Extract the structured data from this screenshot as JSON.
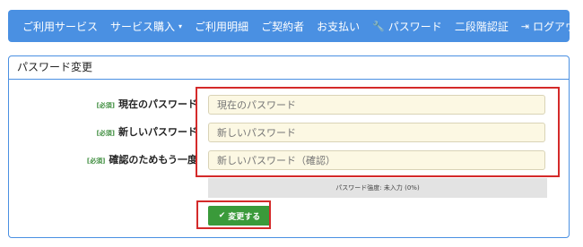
{
  "nav": {
    "items": [
      {
        "label": "ご利用サービス"
      },
      {
        "label": "サービス購入",
        "caret": "▾"
      },
      {
        "label": "ご利用明細"
      },
      {
        "label": "ご契約者"
      },
      {
        "label": "お支払い"
      },
      {
        "label": "パスワード",
        "icon": "wrench-icon"
      },
      {
        "label": "二段階認証"
      }
    ],
    "logout": {
      "label": "ログアウト",
      "icon": "logout-icon"
    }
  },
  "panel": {
    "title": "パスワード変更",
    "required_tag": "[必須]",
    "fields": [
      {
        "label": "現在のパスワード",
        "placeholder": "現在のパスワード"
      },
      {
        "label": "新しいパスワード",
        "placeholder": "新しいパスワード"
      },
      {
        "label": "確認のためもう一度",
        "placeholder": "新しいパスワード（確認）"
      }
    ],
    "strength_text": "パスワード強度: 未入力 (0%)",
    "strength_percent": 0,
    "submit_label": "変更する"
  },
  "colors": {
    "navbar": "#4a90e2",
    "input_bg": "#fcf8e3",
    "button": "#3a9a3a",
    "highlight": "#d42a2a"
  }
}
